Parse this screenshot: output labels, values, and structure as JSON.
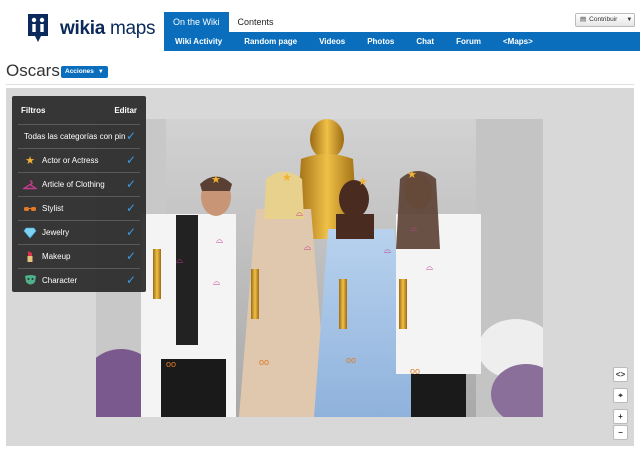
{
  "brand": {
    "bold": "wikia",
    "light": "maps"
  },
  "top_tabs": [
    "On the Wiki",
    "Contents"
  ],
  "nav": [
    "Wiki Activity",
    "Random page",
    "Videos",
    "Photos",
    "Chat",
    "Forum",
    "<Maps>"
  ],
  "contribute": {
    "label": "Contribuir"
  },
  "page": {
    "title": "Oscars",
    "actions": "Acciones"
  },
  "filters": {
    "title": "Filtros",
    "edit": "Editar",
    "all": "Todas las categorías con pin",
    "items": [
      {
        "label": "Actor or Actress",
        "icon": "star-icon"
      },
      {
        "label": "Article of Clothing",
        "icon": "hanger-icon"
      },
      {
        "label": "Stylist",
        "icon": "sunglasses-icon"
      },
      {
        "label": "Jewelry",
        "icon": "diamond-icon"
      },
      {
        "label": "Makeup",
        "icon": "lipstick-icon"
      },
      {
        "label": "Character",
        "icon": "mask-icon"
      }
    ]
  },
  "controls": {
    "embed": "<>",
    "locate": "location-icon",
    "zoom_in": "+",
    "zoom_out": "−"
  },
  "colors": {
    "brand_blue": "#0a6ebd",
    "logo_navy": "#0b2a5b",
    "check_blue": "#3a9be0",
    "star": "#f2b233",
    "hanger": "#c23b8e"
  }
}
